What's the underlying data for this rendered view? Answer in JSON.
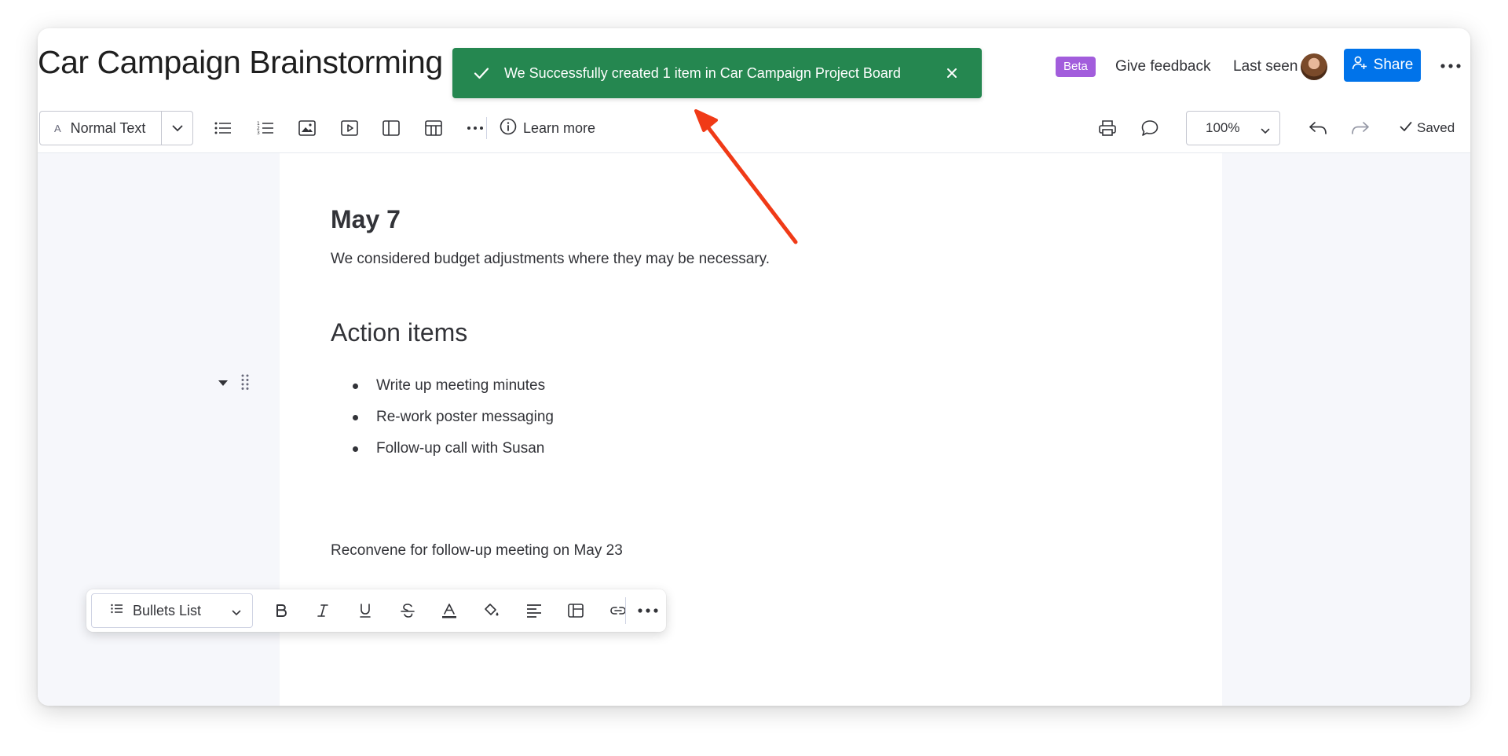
{
  "header": {
    "doc_title": "Car Campaign Brainstorming",
    "beta_badge": "Beta",
    "give_feedback": "Give feedback",
    "last_seen": "Last seen",
    "share_label": "Share"
  },
  "toast": {
    "message": "We Successfully created 1 item in Car Campaign Project Board",
    "color": "#258750"
  },
  "toolbar": {
    "text_style": "Normal Text",
    "text_style_icon": "A",
    "learn_more": "Learn more",
    "zoom": "100%",
    "saved": "Saved"
  },
  "document": {
    "date_heading": "May 7",
    "paragraph_1": "We considered budget adjustments where they may be necessary.",
    "action_heading": "Action items",
    "bullets": [
      "Write up meeting minutes",
      "Re-work poster messaging",
      "Follow-up call with Susan"
    ],
    "paragraph_2": "Reconvene for follow-up meeting on May 23"
  },
  "format_bar": {
    "block_type": "Bullets List"
  },
  "colors": {
    "accent": "#0073ea",
    "beta": "#a25ddc",
    "annotation_arrow": "#f03a17"
  }
}
